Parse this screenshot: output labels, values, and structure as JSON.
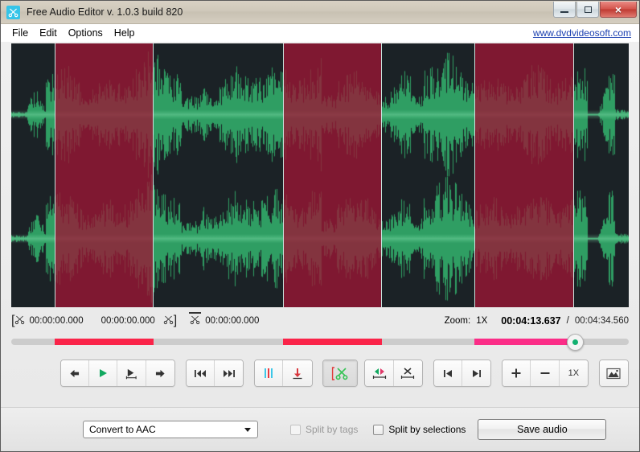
{
  "window": {
    "title": "Free Audio Editor v. 1.0.3 build 820",
    "app_icon": "scissors-icon",
    "minimize_label": "Minimize",
    "maximize_label": "Maximize",
    "close_label": "×"
  },
  "menubar": {
    "items": [
      {
        "label": "File"
      },
      {
        "label": "Edit"
      },
      {
        "label": "Options"
      },
      {
        "label": "Help"
      }
    ],
    "weblink": "www.dvdvideosoft.com"
  },
  "timecodes": {
    "selection_start": "00:00:00.000",
    "selection_end": "00:00:00.000",
    "selection_length": "00:00:00.000",
    "zoom_label": "Zoom:",
    "zoom_value": "1X",
    "current_time": "00:04:13.637",
    "separator": "/",
    "total_time": "00:04:34.560"
  },
  "timeline": {
    "playhead_percent": 91.2,
    "track_color": "#cccccc",
    "segment_color": "#fa2449",
    "segment_active_color": "#fb2d87",
    "handle_dot_color": "#12b070",
    "segments": [
      {
        "start_percent": 7.0,
        "end_percent": 23.0,
        "color": "#fa2449",
        "active": false
      },
      {
        "start_percent": 44.0,
        "end_percent": 60.0,
        "color": "#fa2449",
        "active": false
      },
      {
        "start_percent": 75.0,
        "end_percent": 91.2,
        "color": "#fb2d87",
        "active": true
      }
    ]
  },
  "waveform": {
    "background_color": "#1b2226",
    "wave_color": "#2f9e63",
    "selection_color": "#9b1634",
    "selection_border_color": "#c9e2dc",
    "selections": [
      {
        "start_percent": 7.0,
        "end_percent": 23.0
      },
      {
        "start_percent": 44.0,
        "end_percent": 60.0
      },
      {
        "start_percent": 75.0,
        "end_percent": 91.2
      }
    ]
  },
  "toolbar": {
    "groups": [
      {
        "name": "transport",
        "buttons": [
          {
            "name": "step-back-button",
            "icon": "arrow-left-icon",
            "title": "Previous"
          },
          {
            "name": "play-button",
            "icon": "play-icon",
            "title": "Play"
          },
          {
            "name": "play-selection-button",
            "icon": "play-range-icon",
            "title": "Play selection"
          },
          {
            "name": "step-forward-button",
            "icon": "arrow-right-icon",
            "title": "Next"
          }
        ]
      },
      {
        "name": "skip",
        "buttons": [
          {
            "name": "rewind-button",
            "icon": "rewind-icon",
            "title": "Rewind"
          },
          {
            "name": "fast-forward-button",
            "icon": "fast-forward-icon",
            "title": "Fast forward"
          }
        ]
      },
      {
        "name": "markers",
        "buttons": [
          {
            "name": "add-marker-button",
            "icon": "marker-bars-icon",
            "title": "Add marker"
          },
          {
            "name": "set-marker-button",
            "icon": "marker-down-icon",
            "title": "Set marker"
          }
        ]
      },
      {
        "name": "cut",
        "buttons": [
          {
            "name": "cut-button",
            "icon": "scissors-bracket-icon",
            "title": "Cut selection"
          }
        ]
      },
      {
        "name": "selection-edit",
        "buttons": [
          {
            "name": "move-selection-button",
            "icon": "move-selection-icon",
            "title": "Move selection"
          },
          {
            "name": "delete-selection-button",
            "icon": "delete-selection-icon",
            "title": "Delete selection"
          }
        ]
      },
      {
        "name": "jump",
        "buttons": [
          {
            "name": "jump-start-button",
            "icon": "jump-start-icon",
            "title": "Go to start"
          },
          {
            "name": "jump-end-button",
            "icon": "jump-end-icon",
            "title": "Go to end"
          }
        ]
      },
      {
        "name": "zoom",
        "buttons": [
          {
            "name": "zoom-in-button",
            "icon": "plus-icon",
            "title": "Zoom in"
          },
          {
            "name": "zoom-out-button",
            "icon": "minus-icon",
            "title": "Zoom out"
          },
          {
            "name": "zoom-reset-button",
            "icon": "zoom-level-label",
            "label": "1X",
            "title": "Reset zoom"
          }
        ]
      },
      {
        "name": "view",
        "buttons": [
          {
            "name": "spectrogram-button",
            "icon": "image-icon",
            "title": "Toggle view"
          }
        ]
      }
    ]
  },
  "bottom": {
    "format_select_value": "Convert to AAC",
    "split_by_tags_label": "Split by tags",
    "split_by_tags_checked": false,
    "split_by_tags_disabled": true,
    "split_by_selections_label": "Split by selections",
    "split_by_selections_checked": false,
    "save_button_label": "Save audio"
  }
}
